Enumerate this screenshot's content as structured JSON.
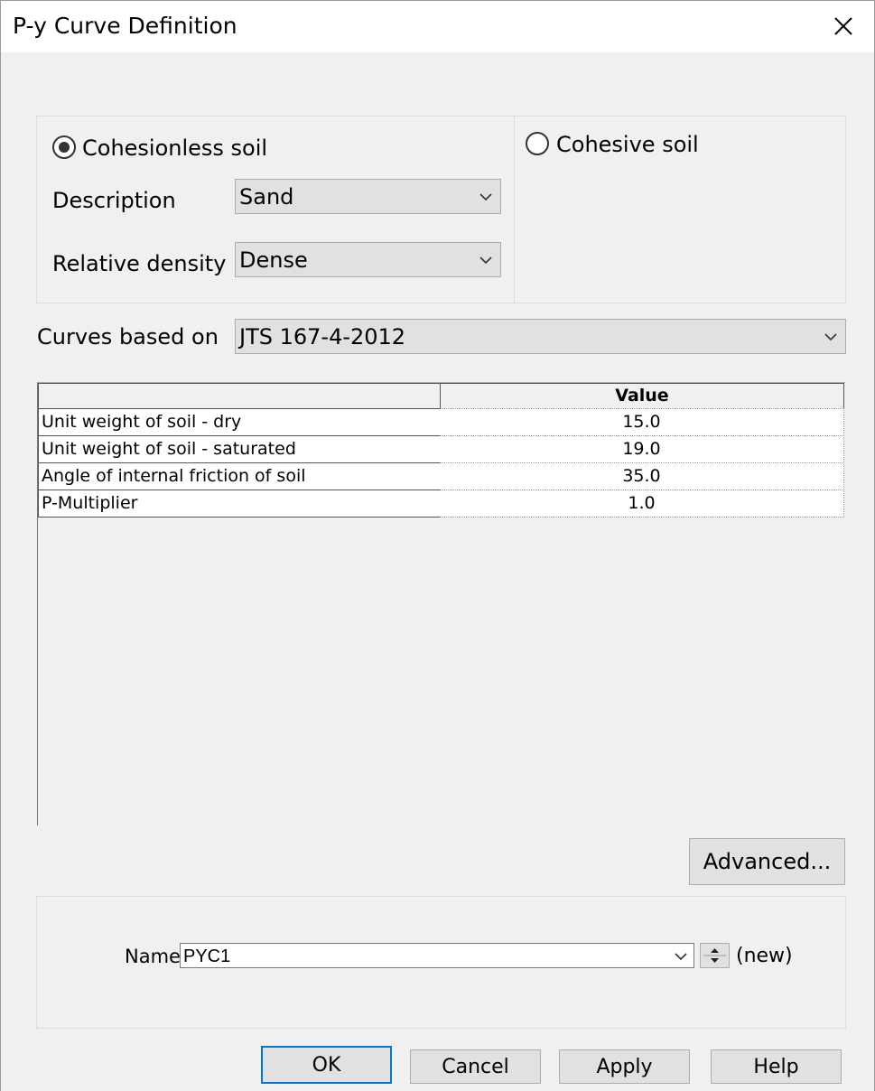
{
  "window": {
    "title": "P-y Curve Definition"
  },
  "soil_type": {
    "cohesionless_label": "Cohesionless soil",
    "cohesive_label": "Cohesive soil",
    "selected": "cohesionless"
  },
  "cohesionless": {
    "description_label": "Description",
    "description_value": "Sand",
    "relative_density_label": "Relative density",
    "relative_density_value": "Dense"
  },
  "curves": {
    "label": "Curves based on",
    "value": "JTS 167-4-2012"
  },
  "table": {
    "columns": [
      "",
      "Value"
    ],
    "rows": [
      {
        "label": "Unit weight of soil - dry",
        "value": "15.0"
      },
      {
        "label": "Unit weight of soil - saturated",
        "value": "19.0"
      },
      {
        "label": "Angle of internal friction of soil",
        "value": "35.0"
      },
      {
        "label": "P-Multiplier",
        "value": "1.0"
      }
    ]
  },
  "advanced_label": "Advanced...",
  "name": {
    "label": "Name",
    "value": "PYC1",
    "status": "(new)"
  },
  "buttons": {
    "ok": "OK",
    "cancel": "Cancel",
    "apply": "Apply",
    "help": "Help"
  },
  "icons": {
    "close": "close-icon",
    "dropdown": "chevron-down-icon",
    "spin": "spin-up-down-icon"
  },
  "colors": {
    "accent": "#0078d7",
    "background": "#f0f0f0"
  }
}
